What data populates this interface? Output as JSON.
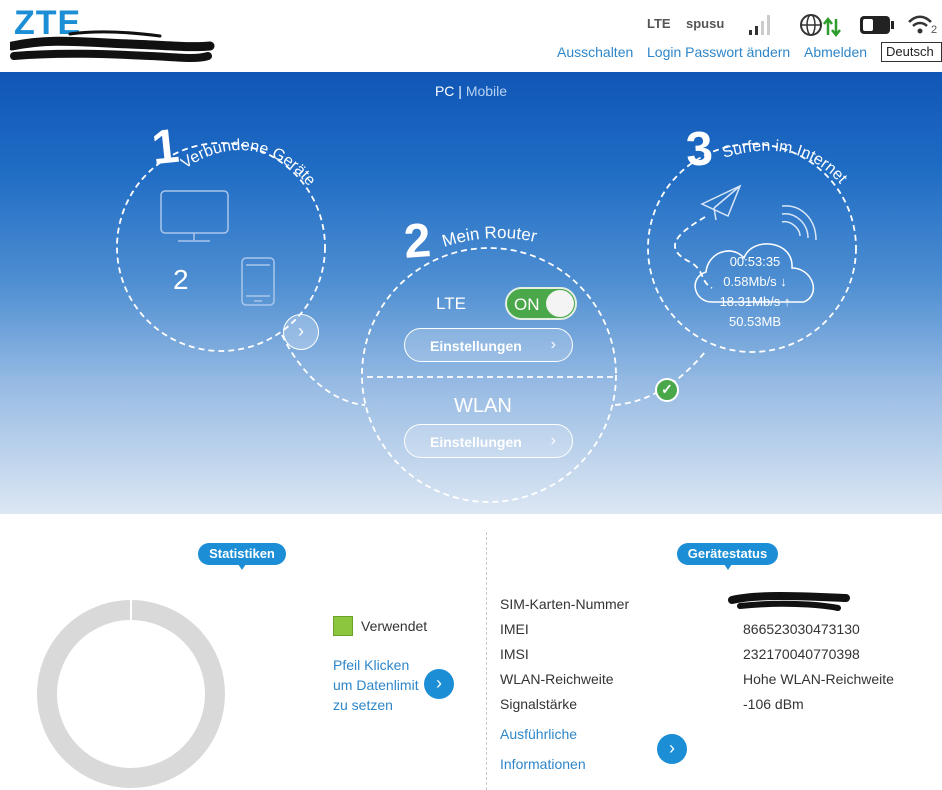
{
  "header": {
    "logo": "ZTE",
    "network_type": "LTE",
    "provider": "spusu",
    "links": {
      "shutdown": "Ausschalten",
      "change_password": "Login Passwort ändern",
      "logout": "Abmelden"
    },
    "language": "Deutsch",
    "wifi_clients": "2",
    "icons": [
      "signal-bars-icon",
      "globe-icon",
      "transfer-arrows-icon",
      "battery-icon",
      "wifi-icon"
    ]
  },
  "hero": {
    "view_toggle": {
      "pc": "PC",
      "separator": "|",
      "mobile": "Mobile"
    },
    "step1": {
      "number": "1",
      "title": "Verbundene Geräte",
      "device_count": "2"
    },
    "step2": {
      "number": "2",
      "title": "Mein Router",
      "lte_label": "LTE",
      "lte_toggle": "ON",
      "lte_settings_button": "Einstellungen",
      "wlan_label": "WLAN",
      "wlan_settings_button": "Einstellungen"
    },
    "step3": {
      "number": "3",
      "title": "Surfen im Internet",
      "connected_time": "00:53:35",
      "download_rate": "0.58Mb/s ↓",
      "upload_rate": "18.31Mb/s ↑",
      "data_used": "50.53MB"
    }
  },
  "statistics": {
    "badge": "Statistiken",
    "legend_used": "Verwendet",
    "used_color": "#8cc63f",
    "ring_color": "#d9d9d9",
    "set_limit_text": [
      "Pfeil Klicken",
      "um Datenlimit",
      "zu setzen"
    ]
  },
  "device_status": {
    "badge": "Gerätestatus",
    "rows": [
      {
        "label": "SIM-Karten-Nummer",
        "value": ""
      },
      {
        "label": "IMEI",
        "value": "866523030473130"
      },
      {
        "label": "IMSI",
        "value": "232170040770398"
      },
      {
        "label": "WLAN-Reichweite",
        "value": "Hohe WLAN-Reichweite"
      },
      {
        "label": "Signalstärke",
        "value": "-106 dBm"
      }
    ],
    "details_link": [
      "Ausführliche",
      "Informationen"
    ]
  },
  "colors": {
    "accent": "#1b8ed6",
    "toggle_on": "#4aa84a",
    "link": "#2e86c9"
  }
}
